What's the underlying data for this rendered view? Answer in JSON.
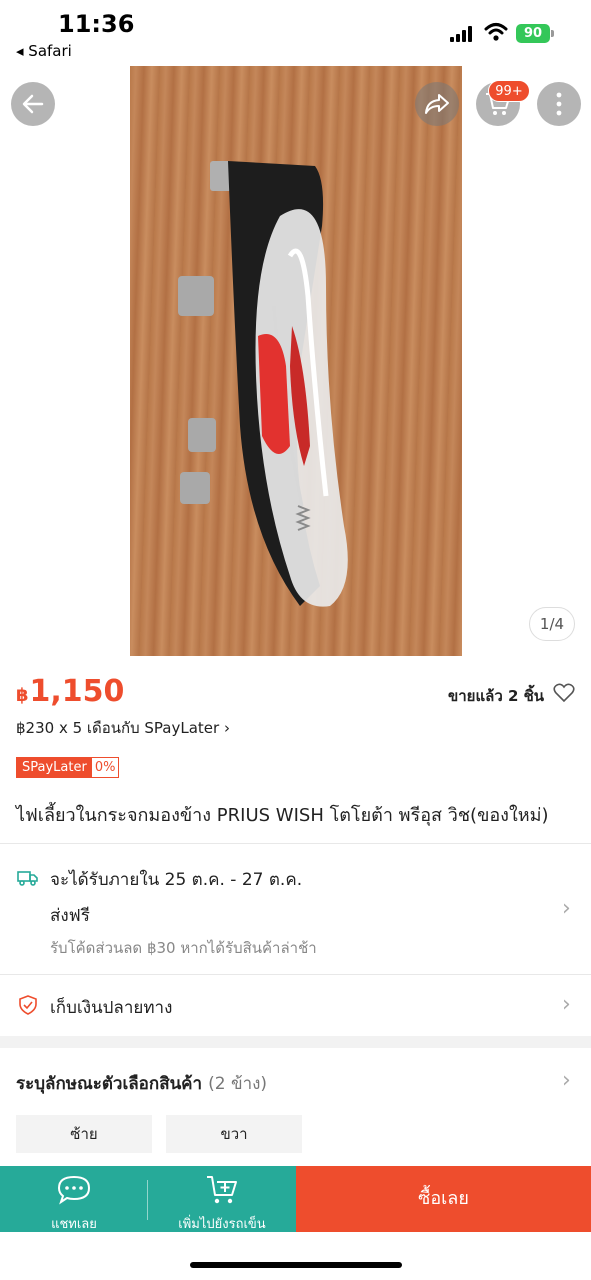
{
  "status_bar": {
    "time": "11:36",
    "back_app": "◂ Safari",
    "battery": "90"
  },
  "gallery": {
    "cart_badge": "99+",
    "counter": "1/4"
  },
  "product": {
    "currency": "฿",
    "price": "1,150",
    "sold": "ขายแล้ว 2 ชิ้น",
    "installment": "฿230 x 5 เดือนกับ SPayLater ›",
    "spay_label": "SPayLater",
    "spay_rate": "0%",
    "title": "ไฟเลี้ยวในกระจกมองข้าง PRIUS WISH โตโยต้า พรีอุส วิช(ของใหม่)"
  },
  "shipping": {
    "date": "จะได้รับภายใน 25 ต.ค. - 27 ต.ค.",
    "free": "ส่งฟรี",
    "note": "รับโค้ดส่วนลด ฿30 หากได้รับสินค้าล่าช้า"
  },
  "cod": {
    "label": "เก็บเงินปลายทาง"
  },
  "variants": {
    "title": "ระบุลักษณะตัวเลือกสินค้า",
    "count": "(2 ข้าง)",
    "options": [
      "ซ้าย",
      "ขวา"
    ]
  },
  "bottom_bar": {
    "chat": "แชทเลย",
    "add_cart": "เพิ่มไปยังรถเข็น",
    "buy": "ซื้อเลย"
  },
  "colors": {
    "brand": "#ee4d2d",
    "teal": "#26aa99"
  }
}
